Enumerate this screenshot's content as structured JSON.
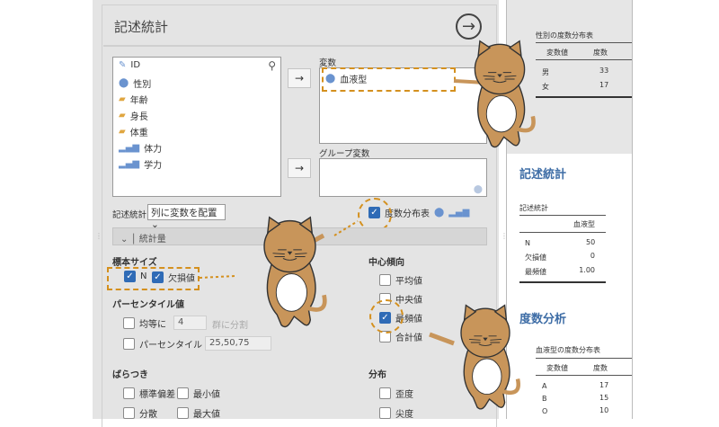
{
  "panel": {
    "title": "記述統計",
    "run_icon": "arrow-circle-right-icon",
    "variables": [
      {
        "name": "ID",
        "icon": "id-icon"
      },
      {
        "name": "性別",
        "icon": "nominal-icon"
      },
      {
        "name": "年齢",
        "icon": "ruler-icon"
      },
      {
        "name": "身長",
        "icon": "ruler-icon"
      },
      {
        "name": "体重",
        "icon": "ruler-icon"
      },
      {
        "name": "体力",
        "icon": "ordinal-icon"
      },
      {
        "name": "学力",
        "icon": "ordinal-icon"
      }
    ],
    "variables_label": "変数",
    "selected_variable": "血液型",
    "group_label": "グループ変数",
    "layout_label": "記述統計",
    "layout_select": "列に変数を配置",
    "freq_table_label": "度数分布表",
    "freq_table_checked": true,
    "section": "統計量",
    "sample_size": {
      "label": "標本サイズ",
      "n": "N",
      "missing": "欠損値"
    },
    "percentile": {
      "label": "パーセンタイル値",
      "equal": "均等に",
      "equal_value": "4",
      "groups": "群に分割",
      "pct": "パーセンタイル",
      "pct_value": "25,50,75"
    },
    "dispersion": {
      "label": "ばらつき",
      "sd": "標準偏差",
      "min": "最小値",
      "var": "分散",
      "max": "最大値"
    },
    "central": {
      "label": "中心傾向",
      "mean": "平均値",
      "median": "中央値",
      "mode": "最頻値",
      "sum": "合計値"
    },
    "distribution": {
      "label": "分布",
      "skew": "歪度",
      "kurt": "尖度"
    },
    "accent": "#2f6bb6",
    "highlight": "#d4901e"
  },
  "results": {
    "sex_table": {
      "title": "性別の度数分布表",
      "cols": [
        "変数値",
        "度数"
      ],
      "rows": [
        [
          "男",
          "33"
        ],
        [
          "女",
          "17"
        ]
      ]
    },
    "desc_heading": "記述統計",
    "desc_table": {
      "title": "記述統計",
      "col": "血液型",
      "rows": [
        [
          "N",
          "50"
        ],
        [
          "欠損値",
          "0"
        ],
        [
          "最頻値",
          "1.00"
        ]
      ]
    },
    "freq_heading": "度数分析",
    "blood_table": {
      "title": "血液型の度数分布表",
      "cols": [
        "変数値",
        "度数"
      ],
      "rows": [
        [
          "A",
          "17"
        ],
        [
          "B",
          "15"
        ],
        [
          "O",
          "10"
        ]
      ]
    },
    "heading_color": "#3e6da6"
  }
}
